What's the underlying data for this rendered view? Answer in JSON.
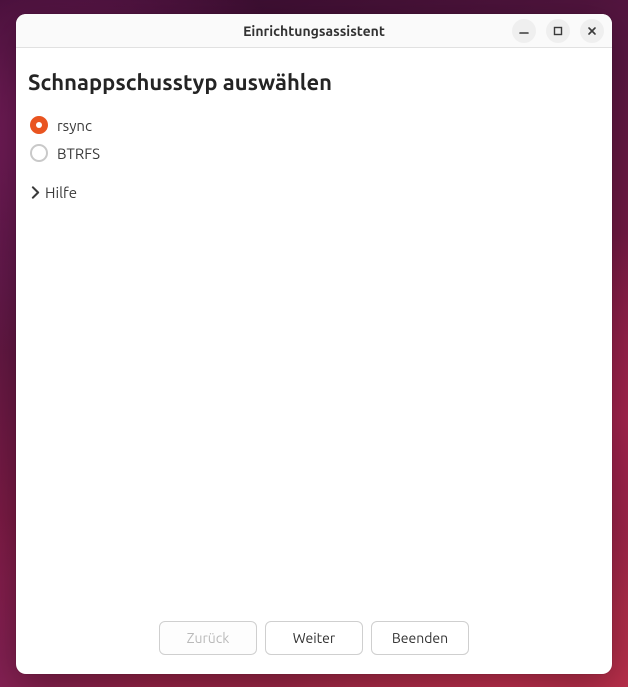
{
  "window": {
    "title": "Einrichtungsassistent"
  },
  "page": {
    "heading": "Schnappschusstyp auswählen"
  },
  "options": {
    "rsync": {
      "label": "rsync",
      "selected": true
    },
    "btrfs": {
      "label": "BTRFS",
      "selected": false
    }
  },
  "help": {
    "label": "Hilfe",
    "expanded": false
  },
  "footer": {
    "back": "Zurück",
    "next": "Weiter",
    "quit": "Beenden"
  },
  "colors": {
    "accent": "#e95420"
  }
}
